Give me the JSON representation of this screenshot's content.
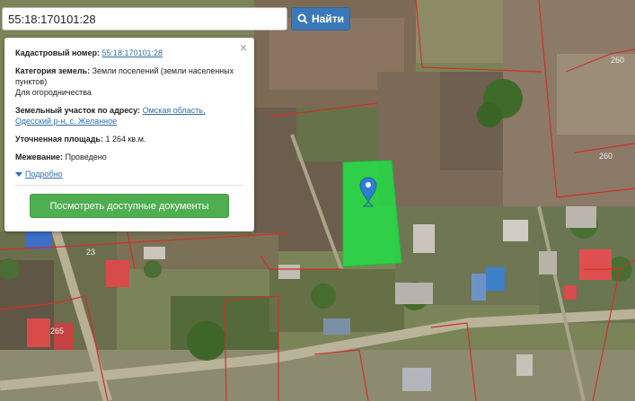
{
  "search": {
    "value": "55:18:170101:28",
    "button_label": "Найти"
  },
  "popup": {
    "cadastral_label": "Кадастровый номер:",
    "cadastral_value": "55:18:170101:28",
    "category_label": "Категория земель:",
    "category_value": "Земли поселений (земли населенных пунктов)",
    "category_use": "Для огородничества",
    "address_label": "Земельный участок по адресу:",
    "address_value_1": "Омская область,",
    "address_value_2": "Одесский р-н, с. Желанное",
    "area_label": "Уточненная площадь:",
    "area_value": "1 264 кв.м.",
    "survey_label": "Межевание:",
    "survey_value": "Проведено",
    "more_label": "Подробно",
    "docs_button": "Посмотреть доступные документы",
    "close_symbol": "×"
  },
  "map": {
    "plot_labels": [
      "260",
      "260",
      "23",
      "265"
    ],
    "plot_color": "#22dd44",
    "boundary_color": "#d0302a",
    "marker_color": "#2f7fd0"
  }
}
